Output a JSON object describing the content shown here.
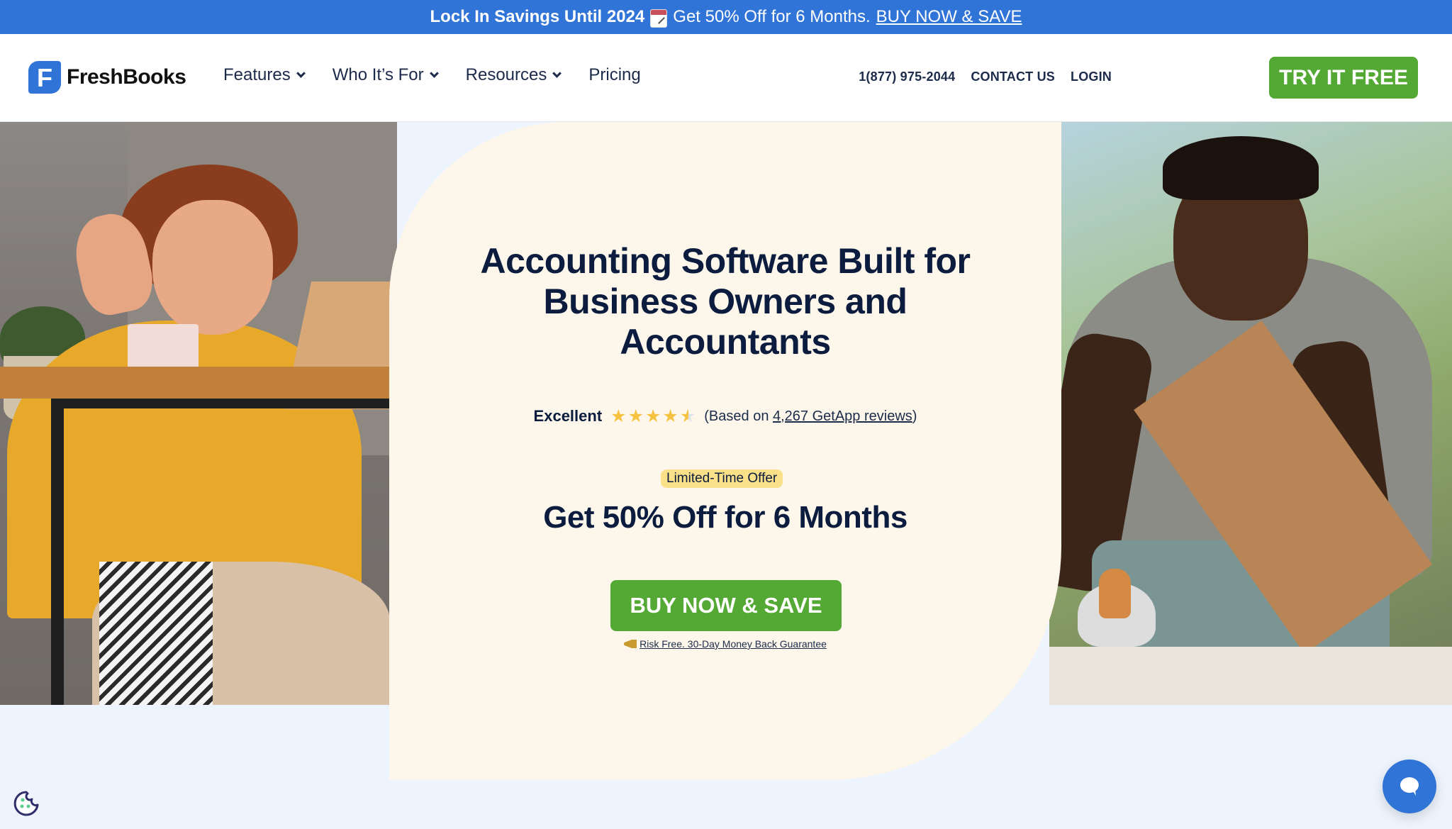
{
  "promo": {
    "bold_text": "Lock In Savings Until 2024",
    "icon": "calendar-icon",
    "text": "Get 50% Off for 6 Months.",
    "link": "BUY NOW & SAVE"
  },
  "header": {
    "logo_text": "FreshBooks",
    "logo_letter": "F",
    "nav": [
      {
        "label": "Features",
        "dropdown": true
      },
      {
        "label": "Who It’s For",
        "dropdown": true
      },
      {
        "label": "Resources",
        "dropdown": true
      },
      {
        "label": "Pricing",
        "dropdown": false
      }
    ],
    "phone": "1(877) 975-2044",
    "contact": "CONTACT US",
    "login": "LOGIN",
    "cta": "TRY IT FREE"
  },
  "hero": {
    "headline_lines": [
      "Accounting Software Built for",
      "Business Owners and",
      "Accountants"
    ],
    "rating": {
      "label": "Excellent",
      "stars": 4.5,
      "max_stars": 5,
      "prefix": "(Based on ",
      "link": "4,267 GetApp reviews",
      "suffix": ")"
    },
    "badge": "Limited-Time Offer",
    "offer": "Get 50% Off for 6 Months",
    "cta": "BUY NOW & SAVE",
    "guarantee_icon": "megaphone-icon",
    "guarantee": "Risk Free. 30-Day Money Back Guarantee",
    "left_photo_alt": "Smiling woman waving at laptop",
    "right_photo_alt": "Man working with wood boards"
  },
  "floating": {
    "cookie_icon": "cookie-icon",
    "chat_icon": "chat-bubble-icon"
  },
  "colors": {
    "brand_blue": "#3174d7",
    "cta_green": "#54a834",
    "navy_text": "#0b1c3f",
    "cream_card": "#fdf7eb",
    "badge_yellow": "#fbe08a",
    "star_gold": "#f5c242",
    "page_bg": "#eef4fd"
  }
}
